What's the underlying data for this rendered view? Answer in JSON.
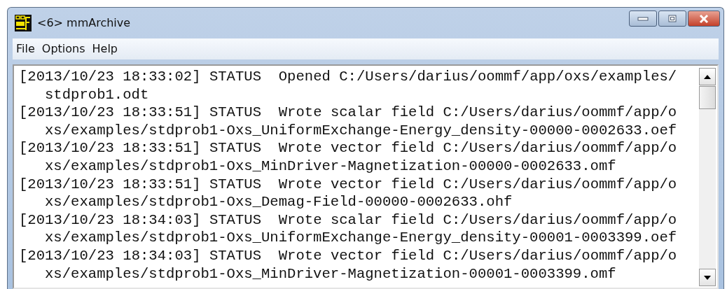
{
  "window": {
    "title": "<6> mmArchive"
  },
  "menu": [
    "File",
    "Options",
    "Help"
  ],
  "log": [
    {
      "first": "[2013/10/23 18:33:02] STATUS  Opened C:/Users/darius/oommf/app/oxs/examples/",
      "wrapped": "stdprob1.odt"
    },
    {
      "first": "[2013/10/23 18:33:51] STATUS  Wrote scalar field C:/Users/darius/oommf/app/o",
      "wrapped": "xs/examples/stdprob1-Oxs_UniformExchange-Energy_density-00000-0002633.oef"
    },
    {
      "first": "[2013/10/23 18:33:51] STATUS  Wrote vector field C:/Users/darius/oommf/app/o",
      "wrapped": "xs/examples/stdprob1-Oxs_MinDriver-Magnetization-00000-0002633.omf"
    },
    {
      "first": "[2013/10/23 18:33:51] STATUS  Wrote vector field C:/Users/darius/oommf/app/o",
      "wrapped": "xs/examples/stdprob1-Oxs_Demag-Field-00000-0002633.ohf"
    },
    {
      "first": "[2013/10/23 18:34:03] STATUS  Wrote scalar field C:/Users/darius/oommf/app/o",
      "wrapped": "xs/examples/stdprob1-Oxs_UniformExchange-Energy_density-00001-0003399.oef"
    },
    {
      "first": "[2013/10/23 18:34:03] STATUS  Wrote vector field C:/Users/darius/oommf/app/o",
      "wrapped": "xs/examples/stdprob1-Oxs_MinDriver-Magnetization-00001-0003399.omf"
    }
  ]
}
